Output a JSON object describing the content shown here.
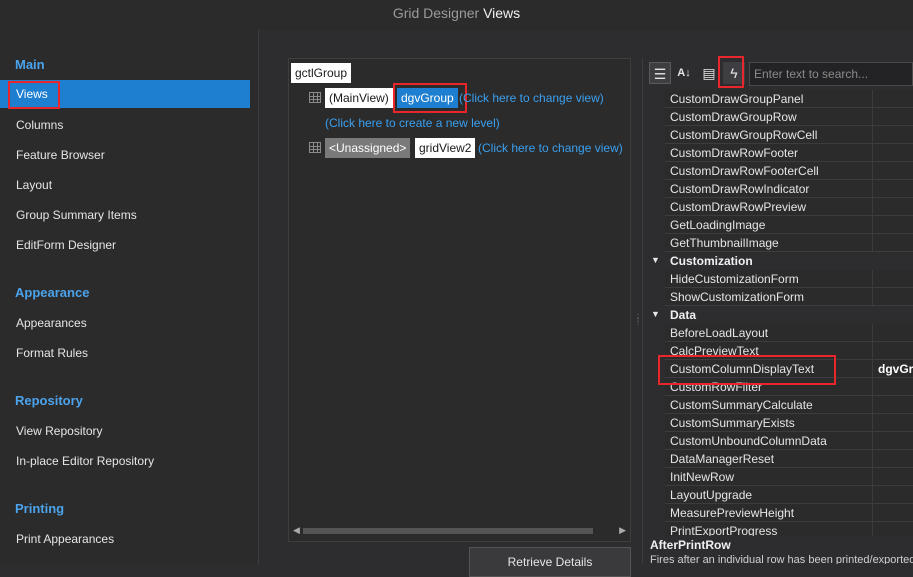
{
  "window": {
    "title_prefix": "Grid Designer",
    "title_section": "Views"
  },
  "nav": {
    "sections": [
      {
        "label": "Main",
        "items": [
          {
            "label": "Views",
            "active": true
          },
          {
            "label": "Columns"
          },
          {
            "label": "Feature Browser"
          },
          {
            "label": "Layout"
          },
          {
            "label": "Group Summary Items"
          },
          {
            "label": "EditForm Designer"
          }
        ]
      },
      {
        "label": "Appearance",
        "items": [
          {
            "label": "Appearances"
          },
          {
            "label": "Format Rules"
          }
        ]
      },
      {
        "label": "Repository",
        "items": [
          {
            "label": "View Repository"
          },
          {
            "label": "In-place Editor Repository"
          }
        ]
      },
      {
        "label": "Printing",
        "items": [
          {
            "label": "Print Appearances"
          }
        ]
      }
    ]
  },
  "level_tree": {
    "root": "gctlGroup",
    "main_level": {
      "tag": "(MainView)",
      "view": "dgvGroup",
      "change_link": "(Click here to change view)"
    },
    "create_link": "(Click here to create a new level)",
    "sub_level": {
      "tag": "<Unassigned>",
      "view": "gridView2",
      "change_link": "(Click here to change view)"
    },
    "retrieve_button": "Retrieve Details"
  },
  "property_grid": {
    "search_placeholder": "Enter text to search...",
    "toolbar": {
      "categorized": "categorized-icon",
      "alphabetical": "sort-az-icon",
      "properties": "property-pages-icon",
      "events": "lightning-icon"
    },
    "rows_a": [
      "CustomDrawGroupPanel",
      "CustomDrawGroupRow",
      "CustomDrawGroupRowCell",
      "CustomDrawRowFooter",
      "CustomDrawRowFooterCell",
      "CustomDrawRowIndicator",
      "CustomDrawRowPreview",
      "GetLoadingImage",
      "GetThumbnailImage"
    ],
    "category_customization": "Customization",
    "rows_b": [
      "HideCustomizationForm",
      "ShowCustomizationForm"
    ],
    "category_data": "Data",
    "rows_c": [
      "BeforeLoadLayout",
      "CalcPreviewText"
    ],
    "selected_row": {
      "name": "CustomColumnDisplayText",
      "value": "dgvGroup_CustomColumnDisplayText"
    },
    "rows_d": [
      "CustomRowFilter",
      "CustomSummaryCalculate",
      "CustomSummaryExists",
      "CustomUnboundColumnData",
      "DataManagerReset",
      "InitNewRow",
      "LayoutUpgrade",
      "MeasurePreviewHeight",
      "PrintExportProgress"
    ],
    "description": {
      "title": "AfterPrintRow",
      "text": "Fires after an individual row has been printed/exported."
    }
  }
}
